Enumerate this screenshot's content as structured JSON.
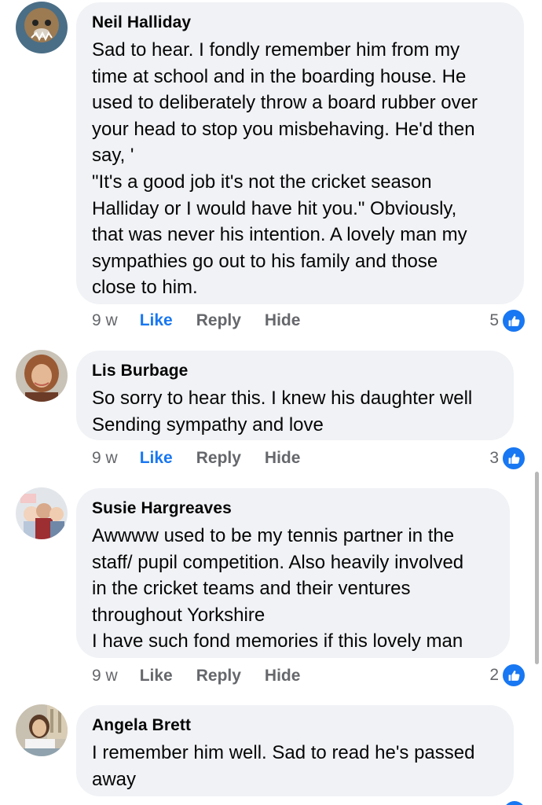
{
  "comments": [
    {
      "author": "Neil Halliday",
      "lines": [
        "Sad to hear. I fondly remember him from my",
        "time at school and in the boarding house. He",
        "used to deliberately throw a board rubber over",
        "your head to stop you misbehaving. He'd then",
        "say, '",
        "\"It's a good job it's not the cricket season",
        "Halliday or I would have hit you.\" Obviously,",
        "that was never his intention. A lovely man my",
        "sympathies go out to his family and those",
        "close to him."
      ],
      "time": "9 w",
      "like_label": "Like",
      "liked": true,
      "reply_label": "Reply",
      "hide_label": "Hide",
      "reaction_count": "5"
    },
    {
      "author": "Lis Burbage",
      "lines": [
        "So sorry to hear this. I knew his daughter well",
        "Sending sympathy and love"
      ],
      "time": "9 w",
      "like_label": "Like",
      "liked": true,
      "reply_label": "Reply",
      "hide_label": "Hide",
      "reaction_count": "3"
    },
    {
      "author": "Susie Hargreaves",
      "lines": [
        "Awwww used to be my tennis partner in the",
        "staff/ pupil competition. Also heavily involved",
        "in the cricket teams and their ventures",
        "throughout Yorkshire",
        "I have such fond memories if this lovely man"
      ],
      "time": "9 w",
      "like_label": "Like",
      "liked": false,
      "reply_label": "Reply",
      "hide_label": "Hide",
      "reaction_count": "2"
    },
    {
      "author": "Angela Brett",
      "lines": [
        "I remember him well. Sad to read he's passed",
        "away"
      ]
    }
  ],
  "colors": {
    "bubble": "#f0f2f5",
    "like_active": "#1877f2",
    "muted": "#65676b",
    "text": "#050505"
  },
  "icons": {
    "reaction": "thumbs-up-icon"
  }
}
